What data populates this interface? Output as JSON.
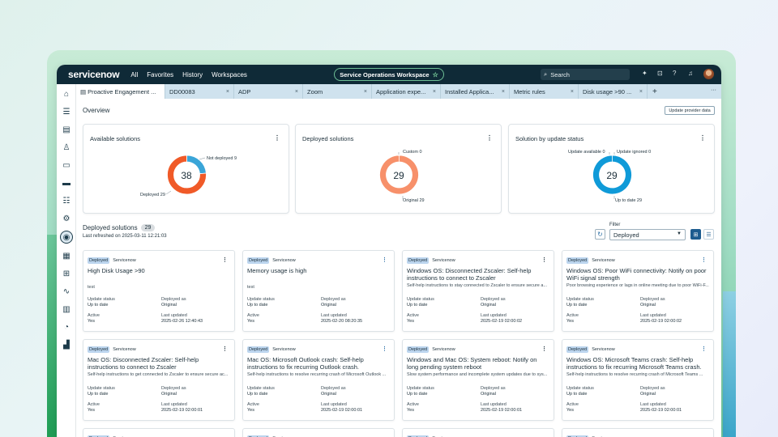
{
  "header": {
    "logo": "servicenow",
    "nav": [
      "All",
      "Favorites",
      "History",
      "Workspaces"
    ],
    "workspace": "Service Operations Workspace",
    "search_placeholder": "Search"
  },
  "tabs": [
    {
      "label": "Proactive Engagement ...",
      "active": true
    },
    {
      "label": "DD00083"
    },
    {
      "label": "ADP"
    },
    {
      "label": "Zoom"
    },
    {
      "label": "Application expe..."
    },
    {
      "label": "Installed Applica..."
    },
    {
      "label": "Metric rules"
    },
    {
      "label": "Disk usage >90 ..."
    }
  ],
  "tab_close": "×",
  "tab_plus": "+",
  "tab_more": "···",
  "overview": {
    "title": "Overview",
    "update_button": "Update provider data"
  },
  "chart_data": [
    {
      "type": "pie",
      "title": "Available solutions",
      "total": "38",
      "slices": [
        {
          "name": "Not deployed",
          "value": 9,
          "color": "#3aa5d8"
        },
        {
          "name": "Deployed",
          "value": 29,
          "color": "#f05a28"
        }
      ]
    },
    {
      "type": "pie",
      "title": "Deployed solutions",
      "total": "29",
      "slices": [
        {
          "name": "Custom",
          "value": 0,
          "color": "#e8b19c"
        },
        {
          "name": "Original",
          "value": 29,
          "color": "#f7906a"
        }
      ]
    },
    {
      "type": "pie",
      "title": "Solution by update status",
      "total": "29",
      "slices": [
        {
          "name": "Update available",
          "value": 0,
          "color": "#8cc7e6"
        },
        {
          "name": "Update ignored",
          "value": 0,
          "color": "#5fb3df"
        },
        {
          "name": "Up to date",
          "value": 29,
          "color": "#0f9ad8"
        }
      ]
    }
  ],
  "deployed": {
    "title": "Deployed solutions",
    "count": "29",
    "refreshed": "Last refreshed on 2025-03-11 12:21:03",
    "filter_label": "Filter",
    "filter_value": "Deployed"
  },
  "card_labels": {
    "badge": "Deployed",
    "source": "Servicenow",
    "update_status": "Update status",
    "deployed_as": "Deployed as",
    "active": "Active",
    "last_updated": "Last updated"
  },
  "cards": [
    {
      "title": "High Disk Usage >90",
      "desc": "test",
      "status": "Up to date",
      "deployed_as": "Original",
      "active": "Yes",
      "updated": "2025-02-26 12:40:43",
      "kebab": "dark"
    },
    {
      "title": "Memory usage is high",
      "desc": "test",
      "status": "Up to date",
      "deployed_as": "Original",
      "active": "Yes",
      "updated": "2025-02-20 08:20:35",
      "kebab": "blue"
    },
    {
      "title": "Windows OS: Disconnected Zscaler: Self-help instructions to connect to Zscaler",
      "desc": "Self-help instructions to stay connected to Zscaler to ensure secure a...",
      "status": "Up to date",
      "deployed_as": "Original",
      "active": "Yes",
      "updated": "2025-02-19 02:00:02",
      "kebab": "dark"
    },
    {
      "title": "Windows OS: Poor WiFi connectivity: Notify on poor WiFi signal strength",
      "desc": "Poor browsing experience or lags in online meeting due to poor WiFi-F...",
      "status": "Up to date",
      "deployed_as": "Original",
      "active": "Yes",
      "updated": "2025-02-19 02:00:02",
      "kebab": "blue"
    },
    {
      "title": "Mac OS: Disconnected Zscaler: Self-help instructions to connect to Zscaler",
      "desc": "Self-help instructions to get connected to Zscaler to ensure secure ac...",
      "status": "Up to date",
      "deployed_as": "Original",
      "active": "Yes",
      "updated": "2025-02-19 02:00:01",
      "kebab": "dark"
    },
    {
      "title": "Mac OS: Microsoft Outlook crash: Self-help instructions to fix recurring Outlook crash.",
      "desc": "Self-help instructions to resolve recurring crash of Microsoft Outlook ...",
      "status": "Up to date",
      "deployed_as": "Original",
      "active": "Yes",
      "updated": "2025-02-19 02:00:01",
      "kebab": "blue"
    },
    {
      "title": "Windows and Mac OS: System reboot: Notify on long pending system reboot",
      "desc": "Slow system performance and incomplete system updates due to sys...",
      "status": "Up to date",
      "deployed_as": "Original",
      "active": "Yes",
      "updated": "2025-02-19 02:00:01",
      "kebab": "dark"
    },
    {
      "title": "Windows OS: Microsoft Teams crash: Self-help instructions to fix recurring Microsoft Teams crash.",
      "desc": "Self-help instructions to resolve recurring crash of Microsoft Teams ...",
      "status": "Up to date",
      "deployed_as": "Original",
      "active": "Yes",
      "updated": "2025-02-19 02:00:01",
      "kebab": "blue"
    }
  ],
  "rail_icons": [
    "home-icon",
    "list-icon",
    "document-icon",
    "user-icon",
    "card-icon",
    "laptop-icon",
    "group-icon",
    "gear-icon",
    "proactive-icon",
    "calendar-gear-icon",
    "grid-icon",
    "pulse-icon",
    "table-icon",
    "gauge-icon",
    "bar-chart-icon"
  ]
}
